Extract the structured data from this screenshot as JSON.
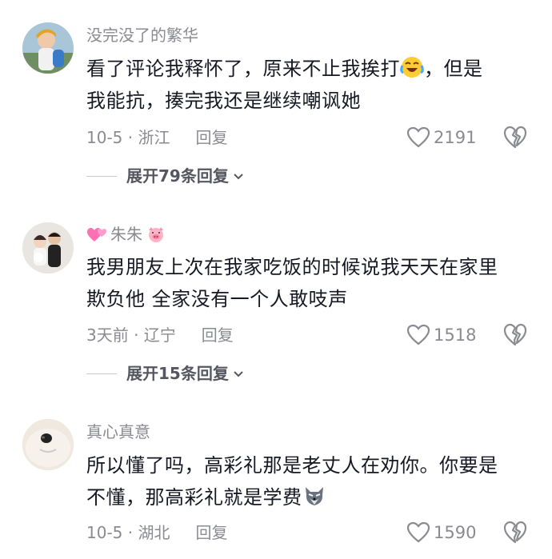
{
  "comments": [
    {
      "username": "没完没了的繁华",
      "line1": "看了评论我释怀了，原来不止我挨打",
      "line1_tail": "，但是",
      "line2": "我能抗，揍完我还是继续嘲讽她",
      "date_location": "10-5 · 浙江",
      "reply_label": "回复",
      "likes": "2191",
      "expand_label": "展开79条回复",
      "emoji": "crying-laughing-emoji"
    },
    {
      "username": "朱朱",
      "line1": "我男朋友上次在我家吃饭的时候说我天天在家里",
      "line2": "欺负他 全家没有一个人敢吱声",
      "date_location": "3天前 · 辽宁",
      "reply_label": "回复",
      "likes": "1518",
      "expand_label": "展开15条回复",
      "badges": [
        "hearts-icon",
        "pig-face-icon"
      ]
    },
    {
      "username": "真心真意",
      "line1": "所以懂了吗，高彩礼那是老丈人在劝你。你要是",
      "line2": "不懂，那高彩礼就是学费",
      "date_location": "10-5 · 湖北",
      "reply_label": "回复",
      "likes": "1590",
      "emoji": "wolf-face-emoji"
    }
  ],
  "colors": {
    "text": "#161823",
    "muted": "#8a8b91",
    "expand": "#555660"
  }
}
